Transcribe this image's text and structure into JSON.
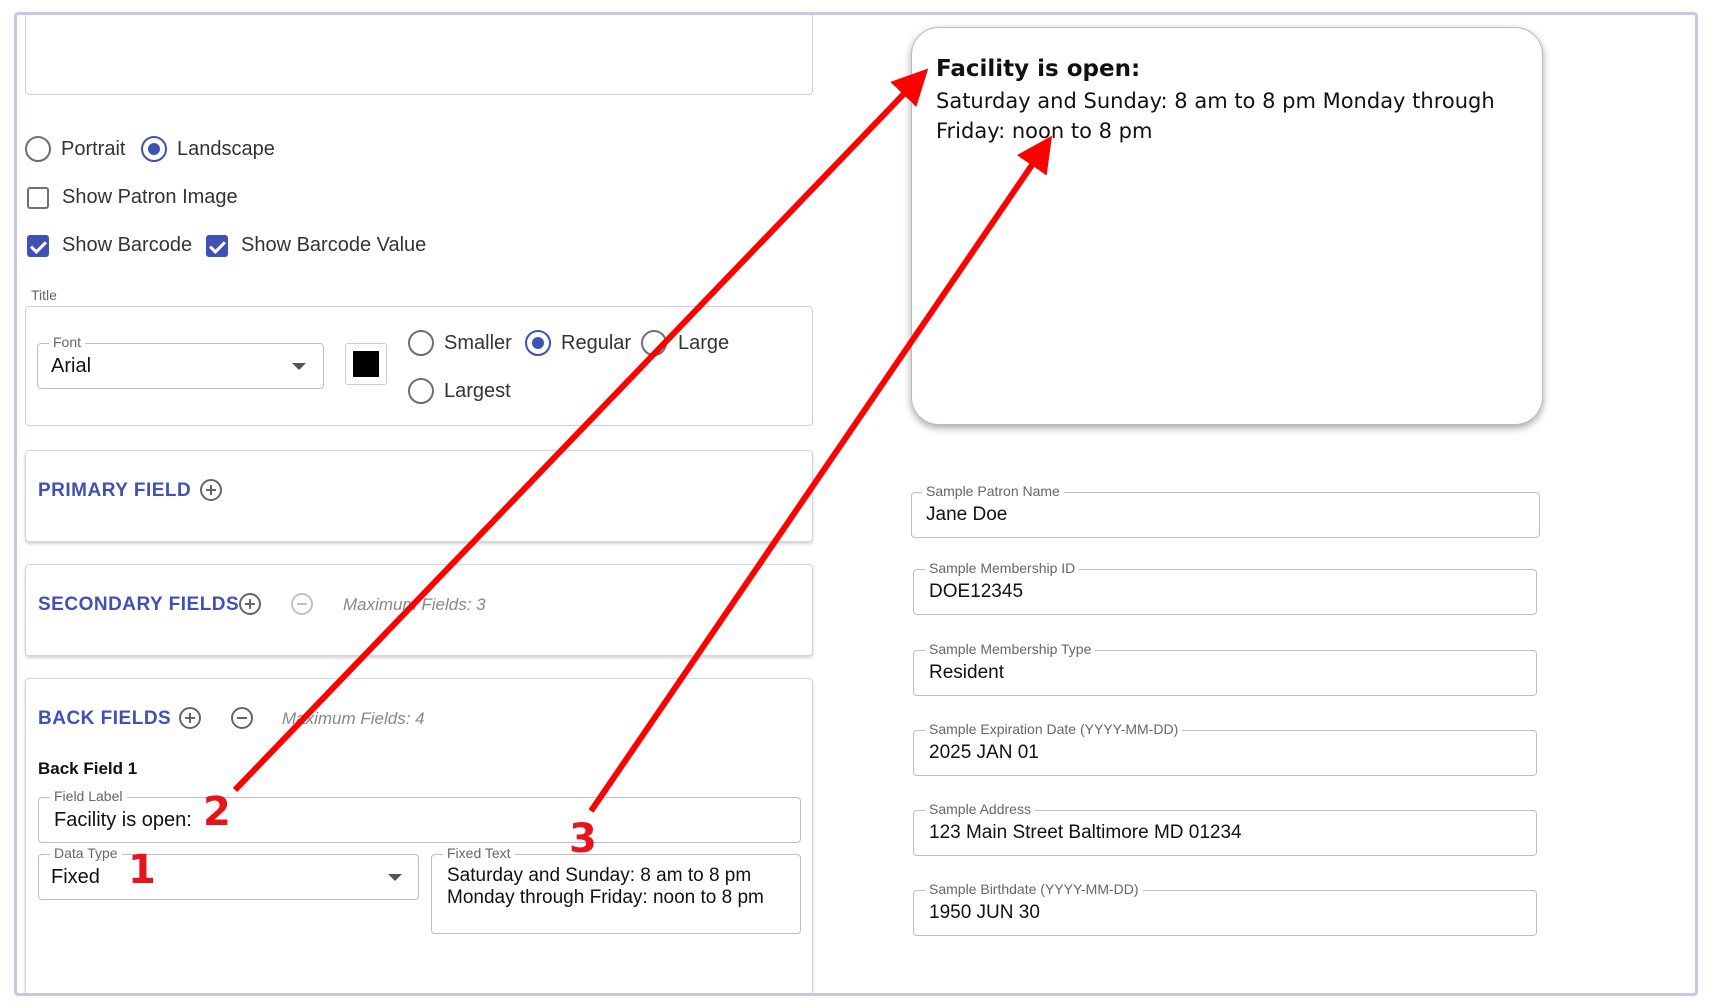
{
  "orientation": {
    "portrait": "Portrait",
    "landscape": "Landscape",
    "selected": "landscape"
  },
  "options": {
    "show_patron_image": "Show Patron Image",
    "show_barcode": "Show Barcode",
    "show_barcode_value": "Show Barcode Value"
  },
  "title_section": {
    "label": "Title",
    "font_legend": "Font",
    "font_value": "Arial",
    "color": "#000000",
    "sizes": [
      "Smaller",
      "Regular",
      "Large",
      "Largest"
    ],
    "selected_size": "Regular"
  },
  "primary": {
    "title": "PRIMARY FIELD"
  },
  "secondary": {
    "title": "SECONDARY FIELDS",
    "max_note": "Maximum Fields: 3"
  },
  "back": {
    "title": "BACK FIELDS",
    "max_note": "Maximum Fields: 4",
    "field1_heading": "Back Field 1",
    "field_label_legend": "Field Label",
    "field_label_value": "Facility is open:",
    "data_type_legend": "Data Type",
    "data_type_value": "Fixed",
    "fixed_text_legend": "Fixed Text",
    "fixed_text_line1": "Saturday and Sunday: 8 am to 8 pm",
    "fixed_text_line2": "Monday through Friday: noon to 8 pm"
  },
  "preview": {
    "title": "Facility is open:",
    "text": "Saturday and Sunday: 8 am to 8 pm Monday through Friday: noon to 8 pm"
  },
  "samples": [
    {
      "legend": "Sample Patron Name",
      "value": "Jane Doe"
    },
    {
      "legend": "Sample Membership ID",
      "value": "DOE12345"
    },
    {
      "legend": "Sample Membership Type",
      "value": "Resident"
    },
    {
      "legend": "Sample Expiration Date (YYYY-MM-DD)",
      "value": "2025 JAN 01"
    },
    {
      "legend": "Sample Address",
      "value": "123 Main Street Baltimore MD 01234"
    },
    {
      "legend": "Sample Birthdate (YYYY-MM-DD)",
      "value": "1950 JUN 30"
    }
  ],
  "annotations": {
    "one": "1",
    "two": "2",
    "three": "3",
    "arrow_color": "#ff0000"
  }
}
